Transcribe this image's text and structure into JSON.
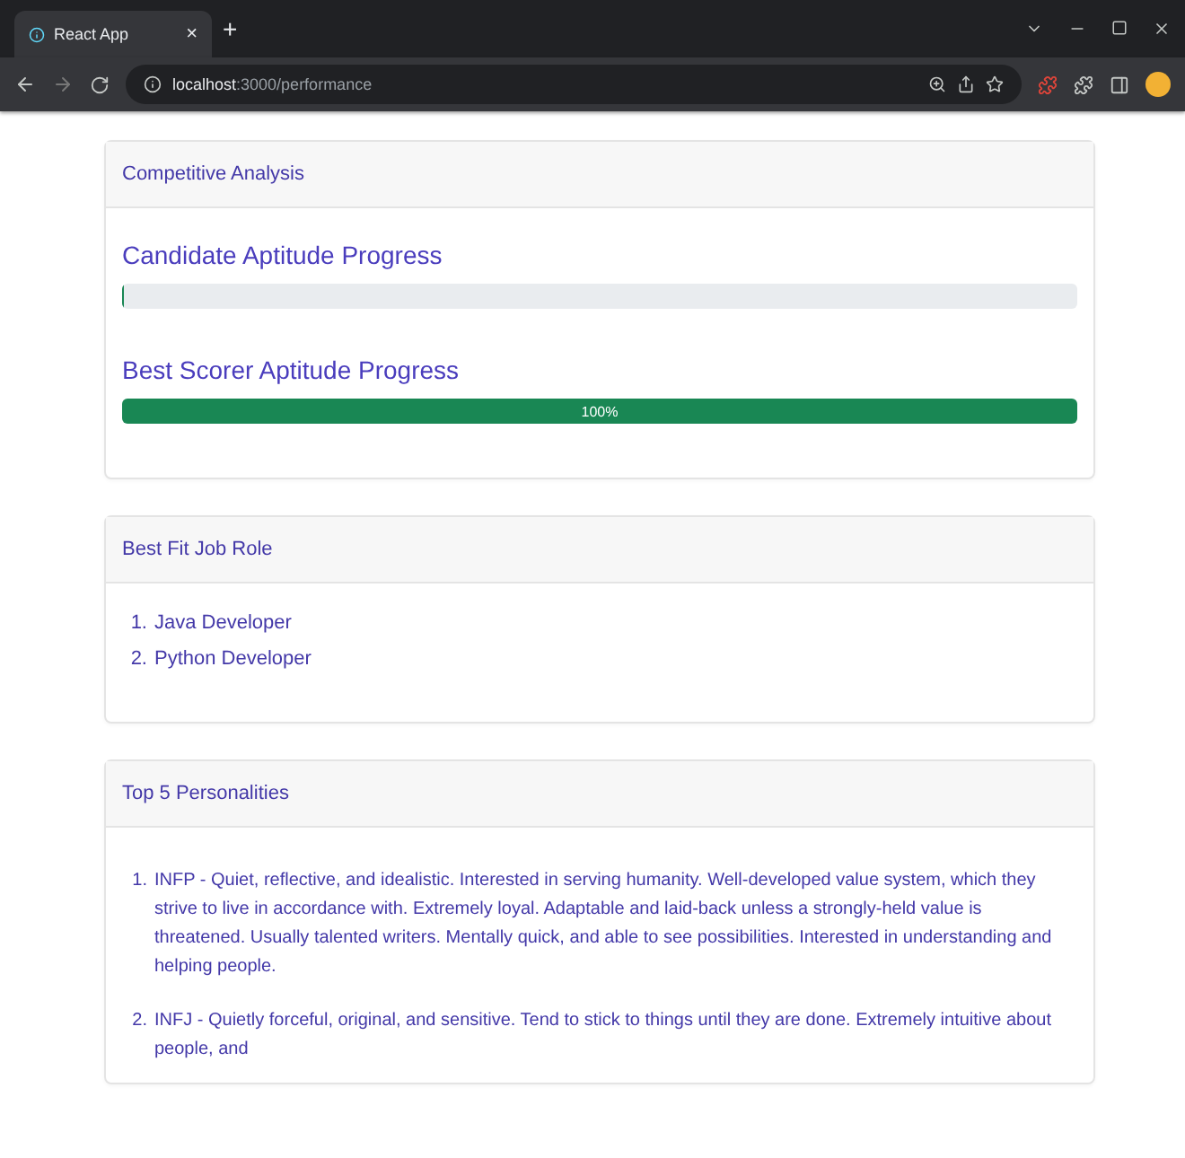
{
  "browser": {
    "tab": {
      "title": "React App",
      "close": "×",
      "new_tab": "+"
    },
    "address": {
      "host": "localhost",
      "path": ":3000/performance"
    }
  },
  "competitive_analysis": {
    "header": "Competitive Analysis",
    "bars": [
      {
        "title": "Candidate Aptitude Progress",
        "level": 0
      },
      {
        "title": "Best Scorer Aptitude Progress",
        "level": 1,
        "label": "100%"
      }
    ]
  },
  "best_fit": {
    "header": "Best Fit Job Role",
    "items": [
      {
        "number": "1.",
        "text": "Java Developer"
      },
      {
        "number": "2.",
        "text": "Python Developer"
      }
    ]
  },
  "personalities": {
    "header": "Top 5 Personalities",
    "items": [
      {
        "number": "1.",
        "text": "INFP - Quiet, reflective, and idealistic. Interested in serving humanity. Well-developed value system, which they strive to live in accordance with. Extremely loyal. Adaptable and laid-back unless a strongly-held value is threatened. Usually talented writers. Mentally quick, and able to see possibilities. Interested in understanding and helping people."
      },
      {
        "number": "2.",
        "text": "INFJ - Quietly forceful, original, and sensitive. Tend to stick to things until they are done. Extremely intuitive about people, and"
      }
    ]
  }
}
